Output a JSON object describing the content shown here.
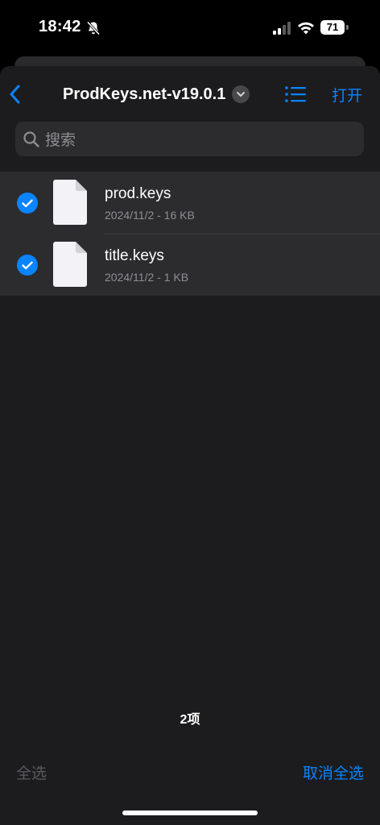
{
  "status_bar": {
    "time": "18:42",
    "battery_level": "71"
  },
  "nav": {
    "title": "ProdKeys.net-v19.0.1",
    "open_label": "打开"
  },
  "search": {
    "placeholder": "搜索"
  },
  "files": [
    {
      "name": "prod.keys",
      "meta": "2024/11/2 - 16 KB",
      "selected": true
    },
    {
      "name": "title.keys",
      "meta": "2024/11/2 - 1 KB",
      "selected": true
    }
  ],
  "footer": {
    "item_count": "2项",
    "select_all_label": "全选",
    "deselect_all_label": "取消全选"
  },
  "colors": {
    "accent": "#0a84ff",
    "sheet_background": "#1c1c1e",
    "selected_row": "#2c2c2e",
    "secondary_text": "#8e8e93"
  },
  "icons": {
    "back": "chevron-left-icon",
    "title_menu": "chevron-down-icon",
    "view": "list-view-icon",
    "search": "search-icon",
    "checkmark": "checkmark-circle-icon",
    "file": "document-icon"
  }
}
